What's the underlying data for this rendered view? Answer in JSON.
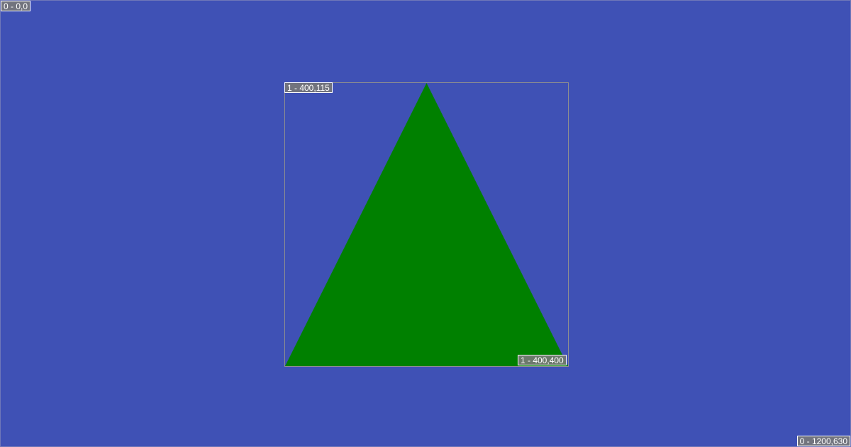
{
  "colors": {
    "background": "#3f51b5",
    "triangle": "#008000",
    "frame_border": "#8f8f8f",
    "label_bg": "#787878",
    "label_text": "#ffffff"
  },
  "labels": {
    "root_origin": "0 - 0,0",
    "root_size": "0 - 1200,630",
    "frame_origin": "1 - 400,115",
    "frame_size": "1 - 400,400"
  },
  "shape": {
    "kind": "triangle",
    "icon": "triangle-shape"
  }
}
